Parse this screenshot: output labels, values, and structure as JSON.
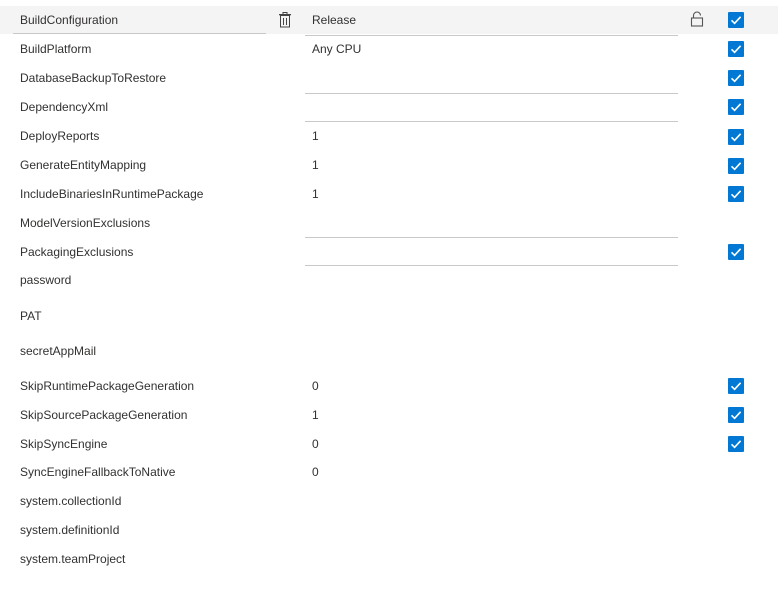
{
  "rows": [
    {
      "name": "BuildConfiguration",
      "value": "Release",
      "checked": true
    },
    {
      "name": "BuildPlatform",
      "value": "Any CPU",
      "checked": true
    },
    {
      "name": "DatabaseBackupToRestore",
      "value": "",
      "checked": true
    },
    {
      "name": "DependencyXml",
      "value": "",
      "checked": true
    },
    {
      "name": "DeployReports",
      "value": "1",
      "checked": true
    },
    {
      "name": "GenerateEntityMapping",
      "value": "1",
      "checked": true
    },
    {
      "name": "IncludeBinariesInRuntimePackage",
      "value": "1",
      "checked": true
    },
    {
      "name": "ModelVersionExclusions",
      "value": "",
      "checked": false
    },
    {
      "name": "PackagingExclusions",
      "value": "",
      "checked": true
    },
    {
      "name": "password",
      "value": "",
      "checked": false
    },
    {
      "name": "PAT",
      "value": "",
      "checked": false
    },
    {
      "name": "secretAppMail",
      "value": "",
      "checked": false
    },
    {
      "name": "SkipRuntimePackageGeneration",
      "value": "0",
      "checked": true
    },
    {
      "name": "SkipSourcePackageGeneration",
      "value": "1",
      "checked": true
    },
    {
      "name": "SkipSyncEngine",
      "value": "0",
      "checked": true
    },
    {
      "name": "SyncEngineFallbackToNative",
      "value": "0",
      "checked": false
    },
    {
      "name": "system.collectionId",
      "value": "",
      "checked": false
    },
    {
      "name": "system.definitionId",
      "value": "",
      "checked": false
    },
    {
      "name": "system.teamProject",
      "value": "",
      "checked": false
    }
  ],
  "icons": {
    "delete": "trash-icon",
    "secret": "lock-icon",
    "checkbox": "check-icon"
  },
  "colors": {
    "accent": "#0078d4",
    "selected_row": "#f4f4f4",
    "underline": "#c8c8c8"
  }
}
